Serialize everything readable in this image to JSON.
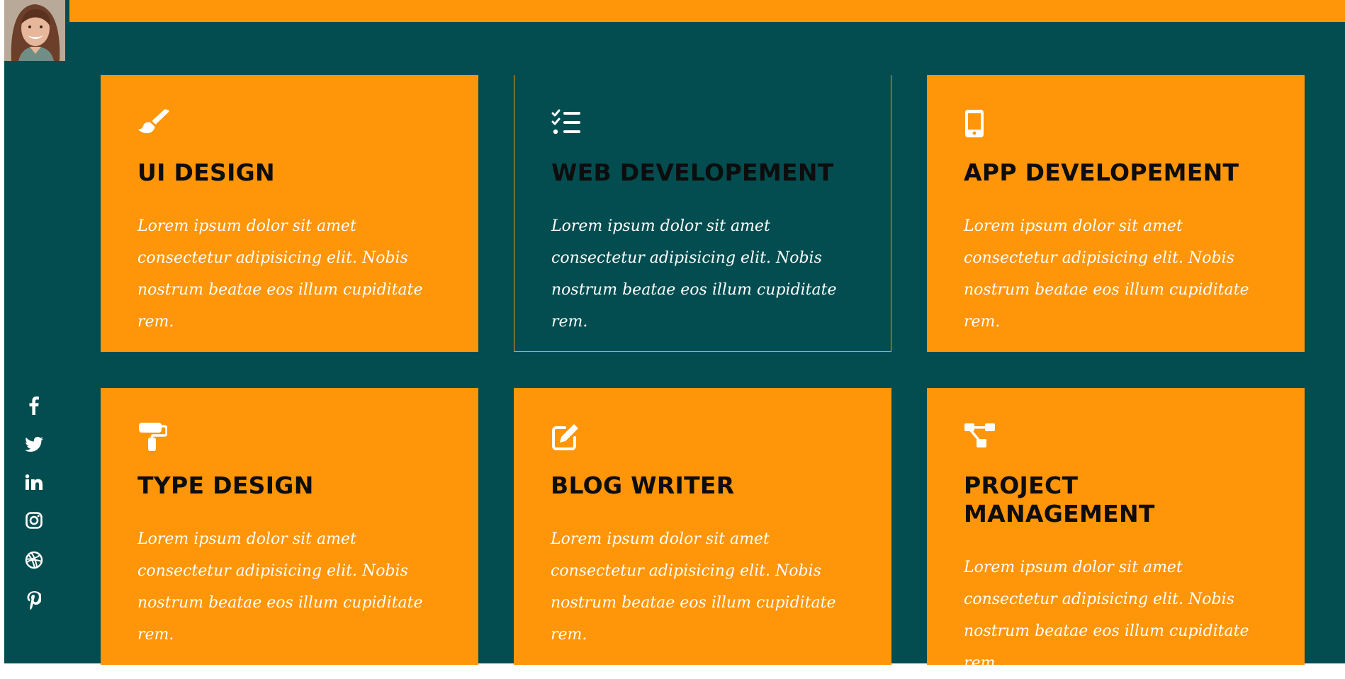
{
  "profile": {
    "avatar_icon": "profile-photo"
  },
  "social": {
    "items": [
      {
        "icon": "facebook-icon"
      },
      {
        "icon": "twitter-icon"
      },
      {
        "icon": "linkedin-icon"
      },
      {
        "icon": "instagram-icon"
      },
      {
        "icon": "dribbble-icon"
      },
      {
        "icon": "pinterest-icon"
      }
    ]
  },
  "colors": {
    "accent": "#ff9509",
    "background": "#034d50",
    "text_dark": "#0d0d0d",
    "text_light": "#ffffff"
  },
  "services": [
    {
      "title": "UI DESIGN",
      "icon": "paint-brush-icon",
      "description": "Lorem ipsum dolor sit amet consectetur adipisicing elit. Nobis nostrum beatae eos illum cupiditate rem."
    },
    {
      "title": "WEB DEVELOPEMENT",
      "icon": "tasks-list-icon",
      "description": "Lorem ipsum dolor sit amet consectetur adipisicing elit. Nobis nostrum beatae eos illum cupiditate rem."
    },
    {
      "title": "APP DEVELOPEMENT",
      "icon": "mobile-phone-icon",
      "description": "Lorem ipsum dolor sit amet consectetur adipisicing elit. Nobis nostrum beatae eos illum cupiditate rem."
    },
    {
      "title": "TYPE DESIGN",
      "icon": "paint-roller-icon",
      "description": "Lorem ipsum dolor sit amet consectetur adipisicing elit. Nobis nostrum beatae eos illum cupiditate rem."
    },
    {
      "title": "BLOG WRITER",
      "icon": "edit-icon",
      "description": "Lorem ipsum dolor sit amet consectetur adipisicing elit. Nobis nostrum beatae eos illum cupiditate rem."
    },
    {
      "title": "PROJECT MANAGEMENT",
      "icon": "project-diagram-icon",
      "description": "Lorem ipsum dolor sit amet consectetur adipisicing elit. Nobis nostrum beatae eos illum cupiditate rem."
    }
  ]
}
